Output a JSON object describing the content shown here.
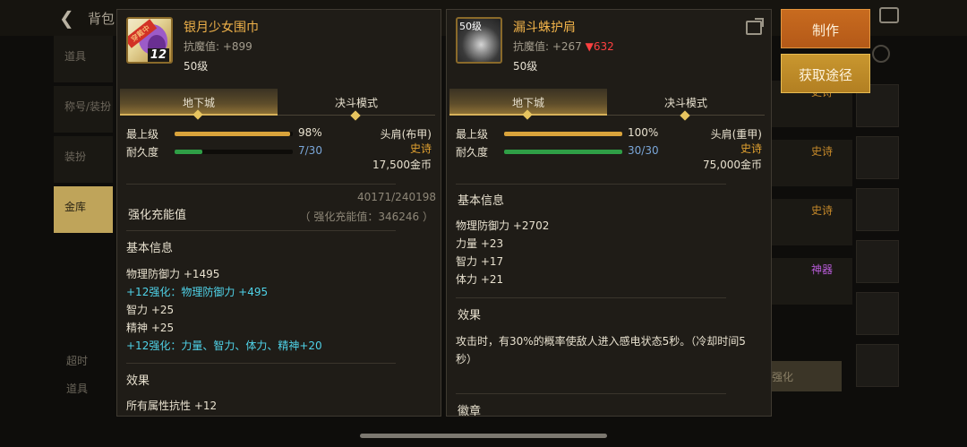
{
  "background": {
    "title": "背包",
    "tabs": [
      "道具",
      "称号/装扮",
      "装扮",
      "金库"
    ],
    "active_tab": "金库",
    "rarity_tags": [
      "史诗",
      "史诗",
      "史诗",
      "神器"
    ],
    "enhance_btn": "强化",
    "left_icons": [
      "超时",
      "道具"
    ]
  },
  "actions": {
    "make_label": "制作",
    "source_label": "获取途径"
  },
  "left_item": {
    "name": "银月少女围巾",
    "resistance": "抗魔值: +899",
    "level": "50级",
    "icon_tag": "穿戴中",
    "icon_enhance": "12",
    "tabs": [
      "地下城",
      "决斗模式"
    ],
    "max_level_label": "最上级",
    "max_level_pct": "98%",
    "max_level_fraction": 0.98,
    "durability_label": "耐久度",
    "durability_text": "7/30",
    "durability_fraction": 0.233,
    "slot_type": "头肩(布甲)",
    "rarity": "史诗",
    "price": "17,500金币",
    "enhance_label": "强化充能值",
    "enhance_value": "40171/240198",
    "enhance_sub": "（ 强化充能值：346246 ）",
    "basic_title": "基本信息",
    "basic_attrs": [
      {
        "text": "物理防御力 +1495",
        "highlight": false
      },
      {
        "text": "+12强化：物理防御力 +495",
        "highlight": true
      },
      {
        "text": "智力 +25",
        "highlight": false
      },
      {
        "text": "精神 +25",
        "highlight": false
      },
      {
        "text": "+12强化：力量、智力、体力、精神+20",
        "highlight": true
      }
    ],
    "effect_title": "效果",
    "effect_text": "所有属性抗性 +12"
  },
  "right_item": {
    "name": "漏斗蛛护肩",
    "resistance_prefix": "抗魔值: +267",
    "resistance_down": "▼632",
    "level": "50级",
    "icon_level": "50级",
    "tabs": [
      "地下城",
      "决斗模式"
    ],
    "max_level_label": "最上级",
    "max_level_pct": "100%",
    "max_level_fraction": 1.0,
    "durability_label": "耐久度",
    "durability_text": "30/30",
    "durability_fraction": 1.0,
    "slot_type": "头肩(重甲)",
    "rarity": "史诗",
    "price": "75,000金币",
    "basic_title": "基本信息",
    "basic_attrs": [
      {
        "text": "物理防御力 +2702",
        "highlight": false
      },
      {
        "text": "力量 +23",
        "highlight": false
      },
      {
        "text": "智力 +17",
        "highlight": false
      },
      {
        "text": "体力 +21",
        "highlight": false
      }
    ],
    "effect_title": "效果",
    "effect_text": "攻击时，有30%的概率使敌人进入感电状态5秒。（冷却时间5秒）",
    "badge_title": "徽章"
  },
  "colors": {
    "item_name": "#f0b24a",
    "rarity_epic": "#e0a130",
    "enhance_cyan": "#4fd2e8",
    "down_red": "#ff4040",
    "make_button": "#c86b1f",
    "source_button": "#c9972f"
  }
}
